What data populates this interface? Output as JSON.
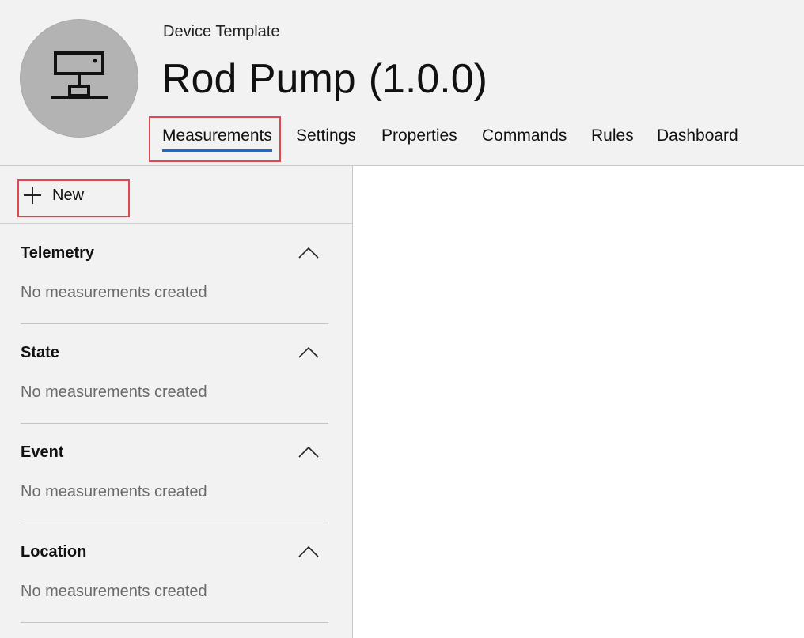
{
  "header": {
    "subtitle": "Device Template",
    "title": "Rod Pump",
    "version": "(1.0.0)"
  },
  "avatar": {
    "icon": "network-device-icon"
  },
  "tabs": [
    {
      "label": "Measurements",
      "active": true
    },
    {
      "label": "Settings",
      "active": false
    },
    {
      "label": "Properties",
      "active": false
    },
    {
      "label": "Commands",
      "active": false
    },
    {
      "label": "Rules",
      "active": false
    },
    {
      "label": "Dashboard",
      "active": false
    }
  ],
  "sidebar": {
    "new_label": "New",
    "sections": [
      {
        "title": "Telemetry",
        "empty_text": "No measurements created"
      },
      {
        "title": "State",
        "empty_text": "No measurements created"
      },
      {
        "title": "Event",
        "empty_text": "No measurements created"
      },
      {
        "title": "Location",
        "empty_text": "No measurements created"
      }
    ]
  },
  "colors": {
    "accent": "#1a6ad6",
    "highlight": "#e0484f",
    "panel_bg": "#f2f2f2",
    "muted_text": "#6a6a6a"
  }
}
